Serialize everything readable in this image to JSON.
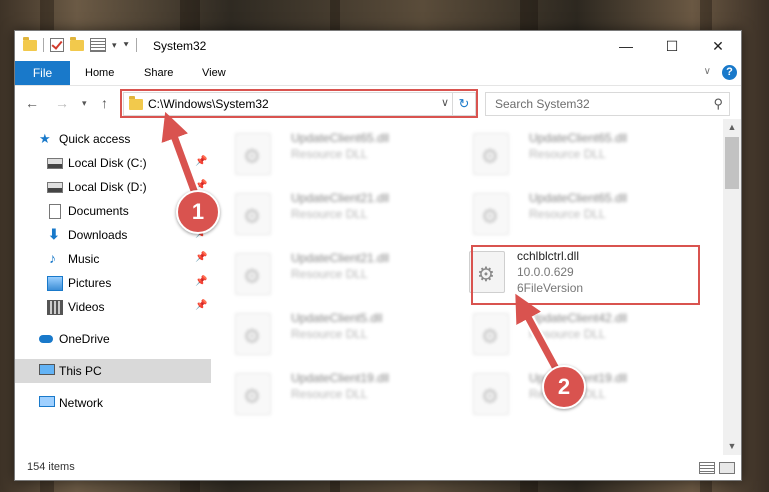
{
  "window": {
    "title": "System32"
  },
  "ribbon": {
    "file": "File",
    "tabs": [
      "Home",
      "Share",
      "View"
    ],
    "help": "?"
  },
  "address": {
    "path": "C:\\Windows\\System32"
  },
  "search": {
    "placeholder": "Search System32"
  },
  "nav": {
    "items": [
      {
        "label": "Quick access",
        "icon": "star-icon"
      },
      {
        "label": "Local Disk (C:)",
        "icon": "disk-icon",
        "pinned": true
      },
      {
        "label": "Local Disk (D:)",
        "icon": "disk-icon",
        "pinned": true
      },
      {
        "label": "Documents",
        "icon": "document-icon",
        "pinned": true
      },
      {
        "label": "Downloads",
        "icon": "download-icon",
        "pinned": true
      },
      {
        "label": "Music",
        "icon": "music-icon",
        "pinned": true
      },
      {
        "label": "Pictures",
        "icon": "picture-icon",
        "pinned": true
      },
      {
        "label": "Videos",
        "icon": "video-icon",
        "pinned": true
      },
      {
        "label": "OneDrive",
        "icon": "cloud-icon"
      },
      {
        "label": "This PC",
        "icon": "computer-icon",
        "selected": true
      },
      {
        "label": "Network",
        "icon": "network-icon"
      }
    ]
  },
  "files": {
    "left": [
      {
        "name": "UpdateClient65.dll",
        "desc": "Resource DLL"
      },
      {
        "name": "UpdateClient21.dll",
        "desc": "Resource DLL"
      },
      {
        "name": "UpdateClient21.dll",
        "desc": "Resource DLL"
      },
      {
        "name": "UpdateClient5.dll",
        "desc": "Resource DLL"
      },
      {
        "name": "UpdateClient19.dll",
        "desc": "Resource DLL"
      }
    ],
    "right": [
      {
        "name": "UpdateClient65.dll",
        "desc": "Resource DLL"
      },
      {
        "name": "UpdateClient65.dll",
        "desc": "Resource DLL"
      },
      {
        "name": "cchlblctrl.dll",
        "desc": "10.0.0.629",
        "desc2": "6FileVersion",
        "highlighted": true
      },
      {
        "name": "UpdateClient42.dll",
        "desc": "Resource DLL"
      },
      {
        "name": "UpdateClient19.dll",
        "desc": "Resource DLL"
      }
    ]
  },
  "status": {
    "count": "154 items"
  },
  "callouts": [
    "1",
    "2"
  ],
  "colors": {
    "accent": "#1979ca",
    "annotation": "#d9534f",
    "selected_nav": "#d9d9d9"
  }
}
